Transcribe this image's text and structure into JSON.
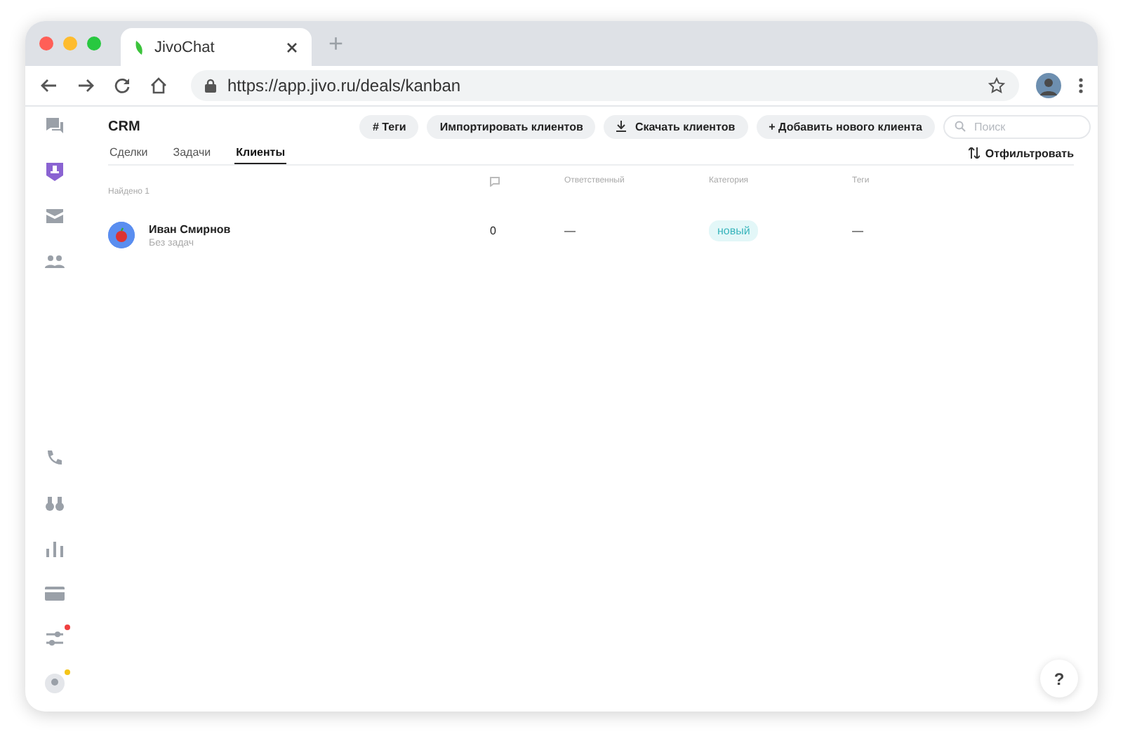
{
  "browser": {
    "tab_title": "JivoChat",
    "new_tab": "+",
    "url": "https://app.jivo.ru/deals/kanban"
  },
  "sidebar": {
    "top": [
      {
        "kind": "chats",
        "selected": false
      },
      {
        "kind": "crm",
        "selected": true
      },
      {
        "kind": "mail",
        "selected": false
      },
      {
        "kind": "team",
        "selected": false
      }
    ],
    "bottom": [
      {
        "kind": "phone",
        "selected": false
      },
      {
        "kind": "binoculars",
        "selected": false
      },
      {
        "kind": "chart",
        "selected": false
      },
      {
        "kind": "card",
        "selected": false
      },
      {
        "kind": "settings",
        "selected": false,
        "color": "#f04040"
      },
      {
        "kind": "profile",
        "selected": false,
        "color": "#f5c518"
      }
    ]
  },
  "header": {
    "title": "CRM",
    "buttons": [
      {
        "kind": "plain",
        "label": "# Теги"
      },
      {
        "kind": "plain",
        "label": "Импортировать клиентов"
      },
      {
        "kind": "download",
        "label": "Скачать клиентов"
      },
      {
        "kind": "plain",
        "label": "+ Добавить нового клиента"
      }
    ],
    "search": {
      "placeholder": "Поиск"
    }
  },
  "tabs": [
    {
      "label": "Сделки",
      "selected": false
    },
    {
      "label": "Задачи",
      "selected": false
    },
    {
      "label": "Клиенты",
      "selected": true
    }
  ],
  "filter_button": "Отфильтровать",
  "table": {
    "found": "Найдено 1",
    "columns": [
      "Ответственный",
      "Категория",
      "Теги"
    ],
    "rows": [
      {
        "name": "Иван Смирнов",
        "subtitle": "Без задач",
        "messages": "0",
        "responsible": "—",
        "category": "новый",
        "tags": "—"
      }
    ]
  },
  "help_button": "?"
}
